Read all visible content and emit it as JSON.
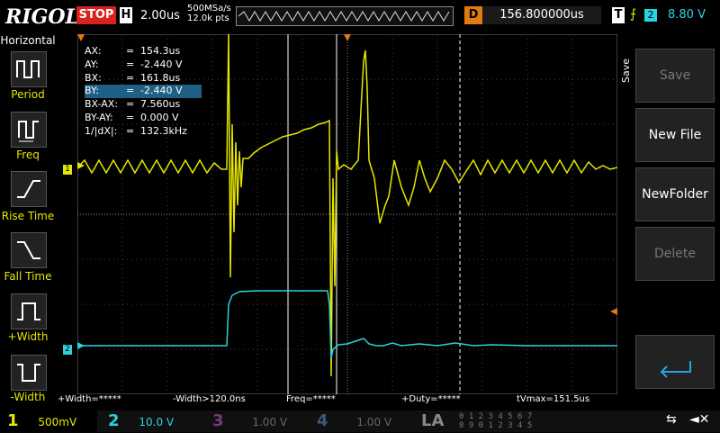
{
  "top": {
    "logo": "RIGOL",
    "run_state": "STOP",
    "h_label": "H",
    "timebase": "2.00us",
    "sample_rate": "500MSa/s",
    "points": "12.0k pts",
    "delay_label": "D",
    "delay_value": "156.800000us",
    "trigger_label": "T",
    "trigger_channel": "2",
    "trigger_level": "8.80 V"
  },
  "left_panel": {
    "title": "Horizontal",
    "items": [
      {
        "label": "Period",
        "icon": "period-icon"
      },
      {
        "label": "Freq",
        "icon": "freq-icon"
      },
      {
        "label": "Rise Time",
        "icon": "rise-time-icon"
      },
      {
        "label": "Fall Time",
        "icon": "fall-time-icon"
      },
      {
        "label": "+Width",
        "icon": "pos-width-icon"
      },
      {
        "label": "-Width",
        "icon": "neg-width-icon"
      }
    ]
  },
  "cursors": [
    {
      "key": "AX:",
      "value": "154.3us"
    },
    {
      "key": "AY:",
      "value": "-2.440 V"
    },
    {
      "key": "BX:",
      "value": "161.8us"
    },
    {
      "key": "BY:",
      "value": "-2.440 V"
    },
    {
      "key": "BX-AX:",
      "value": "7.560us"
    },
    {
      "key": "BY-AY:",
      "value": "0.000 V"
    },
    {
      "key": "1/|dX|:",
      "value": "132.3kHz"
    }
  ],
  "measurements": {
    "pos_width": "+Width=*****",
    "neg_width": "-Width>120.0ns",
    "freq": "Freq=*****",
    "duty": "+Duty=*****",
    "tvmax": "tVmax=151.5us"
  },
  "right_panel": {
    "title": "Save",
    "buttons": [
      {
        "label": "Save",
        "enabled": false
      },
      {
        "label": "New File",
        "enabled": true
      },
      {
        "label": "NewFolder",
        "enabled": true
      },
      {
        "label": "Delete",
        "enabled": false
      }
    ]
  },
  "bottom": {
    "ch1": {
      "num": "1",
      "scale": "500mV",
      "color": "#e6e600"
    },
    "ch2": {
      "num": "2",
      "scale": "10.0 V",
      "color": "#29d3e0"
    },
    "ch3": {
      "num": "3",
      "scale": "1.00 V",
      "color": "#7a3a7a"
    },
    "ch4": {
      "num": "4",
      "scale": "1.00 V",
      "color": "#3a5a7a"
    },
    "la": "LA",
    "la_row1": "0 1 2 3  4 5 6 7",
    "la_row2": "8 9 0 1  2 3 4 5"
  },
  "trace_markers": {
    "ch1": "1",
    "ch2": "2"
  },
  "colors": {
    "ch1": "#e6e600",
    "ch2": "#29d3e0",
    "accent_orange": "#e07b14",
    "stop_red": "#d8221c"
  }
}
